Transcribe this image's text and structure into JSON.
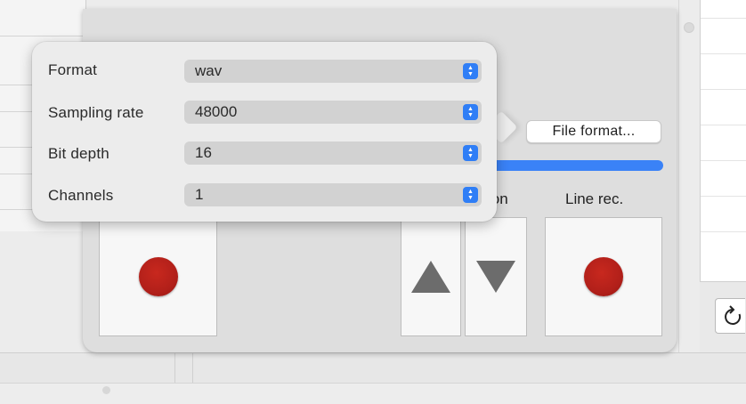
{
  "popover": {
    "rows": [
      {
        "label": "Format",
        "value": "wav"
      },
      {
        "label": "Sampling rate",
        "value": "48000"
      },
      {
        "label": "Bit depth",
        "value": "16"
      },
      {
        "label": "Channels",
        "value": "1"
      }
    ]
  },
  "panel": {
    "file_format_button": "File format...",
    "position_label_visible": "ion",
    "line_rec_label": "Line rec."
  },
  "colors": {
    "accent": "#3a82f7",
    "record": "#b2201a",
    "stepper": "#2f7ef6"
  },
  "icons": {
    "mic_record": "record-dot-icon",
    "up": "triangle-up-icon",
    "down": "triangle-down-icon",
    "line_record": "record-dot-icon",
    "refresh": "refresh-icon",
    "select_stepper": "updown-chevron-icon"
  }
}
